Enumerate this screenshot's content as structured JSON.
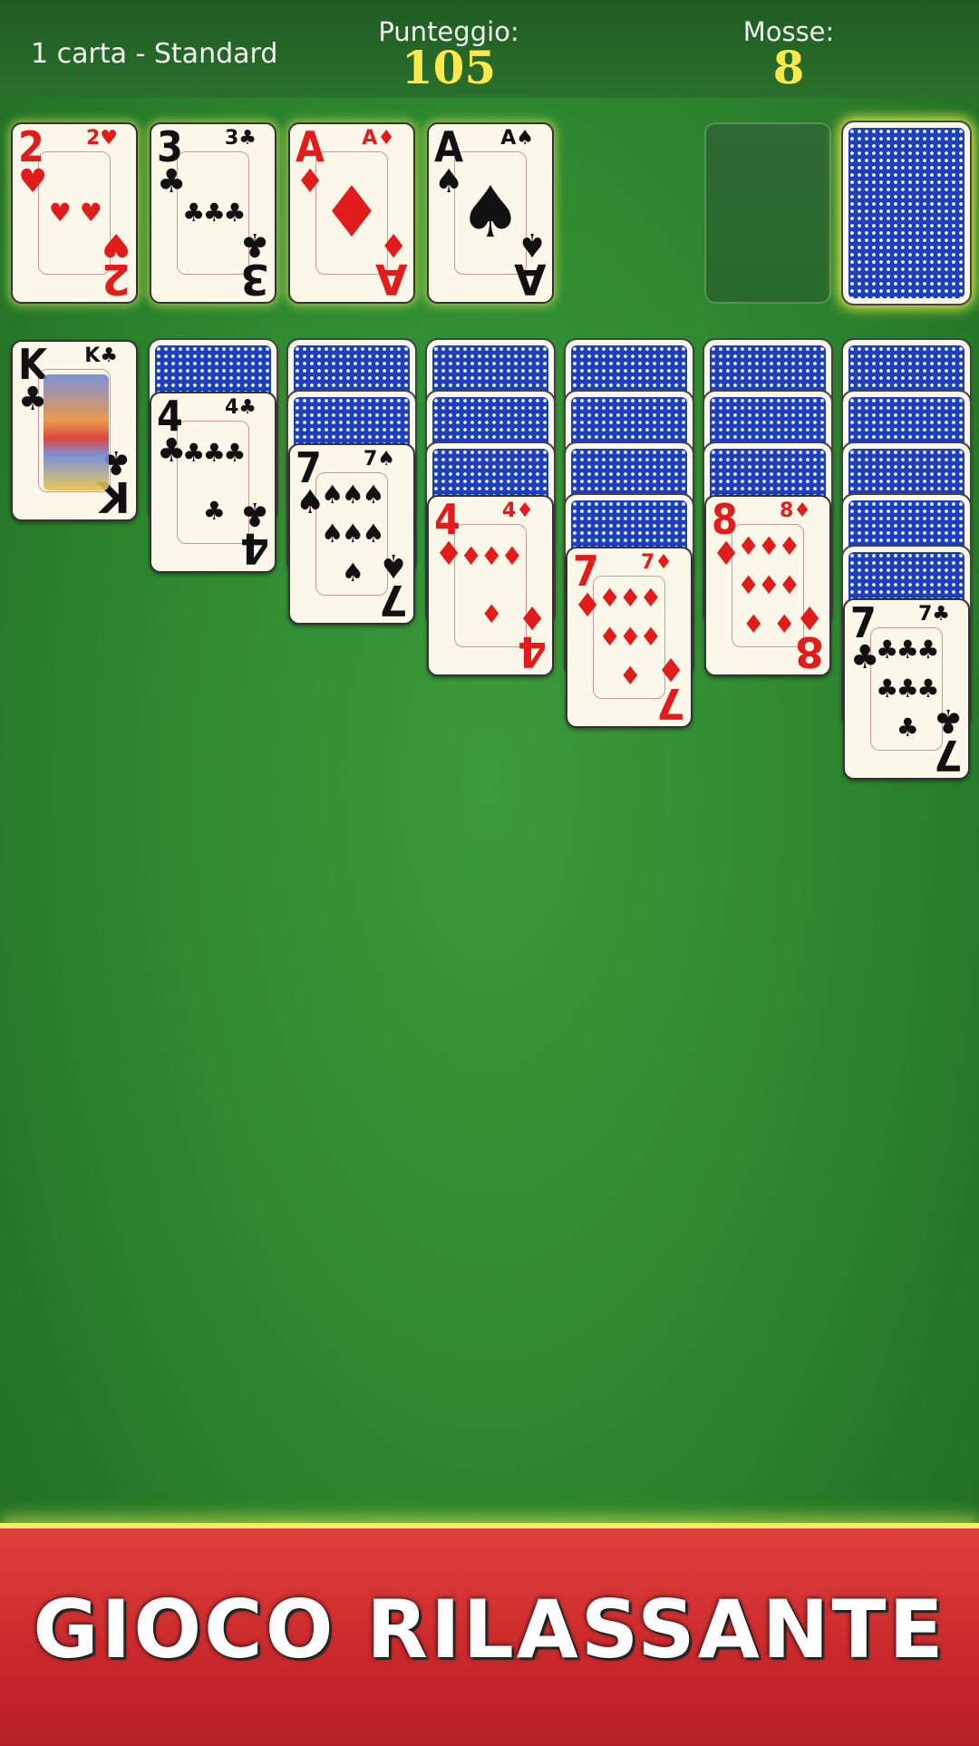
{
  "header": {
    "mode": "1 carta - Standard",
    "score_label": "Punteggio:",
    "score_value": "105",
    "moves_label": "Mosse:",
    "moves_value": "8"
  },
  "foundations": [
    {
      "rank": "2",
      "suit": "♥",
      "color": "red"
    },
    {
      "rank": "3",
      "suit": "♣",
      "color": "black"
    },
    {
      "rank": "A",
      "suit": "♦",
      "color": "red"
    },
    {
      "rank": "A",
      "suit": "♠",
      "color": "black"
    }
  ],
  "waste_empty": true,
  "stock_face_down": true,
  "tableau": [
    {
      "hidden": 0,
      "rank": "K",
      "suit": "♣",
      "color": "black",
      "pips": 0
    },
    {
      "hidden": 1,
      "rank": "4",
      "suit": "♣",
      "color": "black",
      "pips": 4
    },
    {
      "hidden": 2,
      "rank": "7",
      "suit": "♠",
      "color": "black",
      "pips": 7
    },
    {
      "hidden": 3,
      "rank": "4",
      "suit": "♦",
      "color": "red",
      "pips": 4
    },
    {
      "hidden": 4,
      "rank": "7",
      "suit": "♦",
      "color": "red",
      "pips": 7
    },
    {
      "hidden": 3,
      "rank": "8",
      "suit": "♦",
      "color": "red",
      "pips": 8
    },
    {
      "hidden": 5,
      "rank": "7",
      "suit": "♣",
      "color": "black",
      "pips": 7
    }
  ],
  "banner": {
    "text": "GIOCO RILASSANTE"
  },
  "colors": {
    "table": "#2f8a30",
    "score": "#ffe84a",
    "banner": "#c9282a",
    "red_suit": "#e21b1b"
  }
}
